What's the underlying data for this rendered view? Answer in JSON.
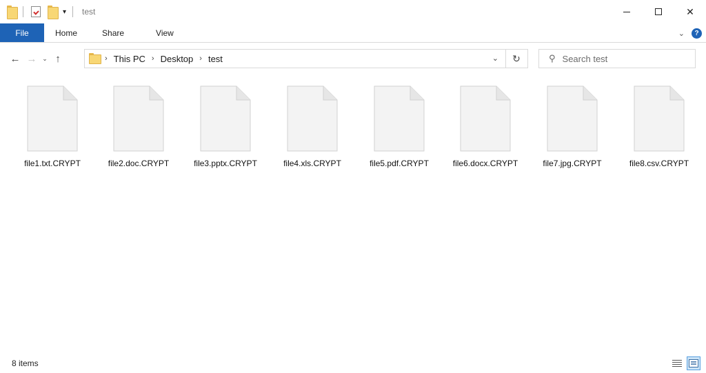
{
  "window": {
    "title": "test"
  },
  "ribbon": {
    "tabs": [
      {
        "label": "File"
      },
      {
        "label": "Home"
      },
      {
        "label": "Share"
      },
      {
        "label": "View"
      }
    ],
    "help_icon": "?"
  },
  "nav": {
    "back_icon": "←",
    "forward_icon": "→",
    "recent_icon": "⌄",
    "up_icon": "↑",
    "dropdown_icon": "⌄",
    "refresh_icon": "↻",
    "breadcrumb": [
      "This PC",
      "Desktop",
      "test"
    ]
  },
  "search": {
    "placeholder": "Search test"
  },
  "files": [
    {
      "name": "file1.txt.CRYPT"
    },
    {
      "name": "file2.doc.CRYPT"
    },
    {
      "name": "file3.pptx.CRYPT"
    },
    {
      "name": "file4.xls.CRYPT"
    },
    {
      "name": "file5.pdf.CRYPT"
    },
    {
      "name": "file6.docx.CRYPT"
    },
    {
      "name": "file7.jpg.CRYPT"
    },
    {
      "name": "file8.csv.CRYPT"
    }
  ],
  "status": {
    "item_count": "8 items"
  },
  "icons": {
    "file": "generic-file-icon",
    "folder": "folder-icon"
  },
  "colors": {
    "accent": "#1e63b6"
  }
}
